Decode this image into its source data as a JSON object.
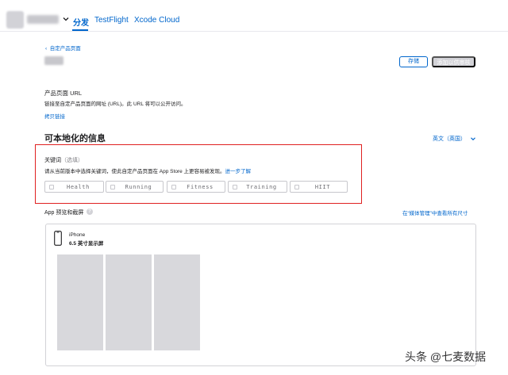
{
  "topnav": {
    "tabs": [
      {
        "label": "分发",
        "active": true
      },
      {
        "label": "TestFlight",
        "active": false
      },
      {
        "label": "Xcode Cloud",
        "active": false
      }
    ]
  },
  "header": {
    "breadcrumb": "自定产品页面",
    "save_label": "存储",
    "submit_label": "添加以供审核"
  },
  "url_section": {
    "title": "产品页面 URL",
    "description": "链接至自定产品页面的网址 (URL)。此 URL 将可以公开访问。",
    "copy_link": "拷贝链接"
  },
  "localizable": {
    "title": "可本地化的信息",
    "language": "英文（英国）"
  },
  "keywords": {
    "label": "关键词",
    "optional": "（选填）",
    "help": "请从当前版本中选择关键词，使此自定产品页面在 App Store 上更容易被发现。",
    "learn_more": "进一步了解",
    "items": [
      "Health",
      "Running",
      "Fitness",
      "Training",
      "HIIT"
    ]
  },
  "preview": {
    "label": "App 预览和截屏",
    "help_icon": "?",
    "media_link": "在“媒体管理”中查看所有尺寸",
    "device_name": "iPhone",
    "device_size": "6.5 英寸显示屏"
  },
  "watermark": "头条 @七麦数据",
  "colors": {
    "accent": "#0066cc",
    "highlight_border": "#e02020",
    "disabled_button": "#d2d2d7",
    "screenshot_placeholder": "#d8d8dc"
  }
}
